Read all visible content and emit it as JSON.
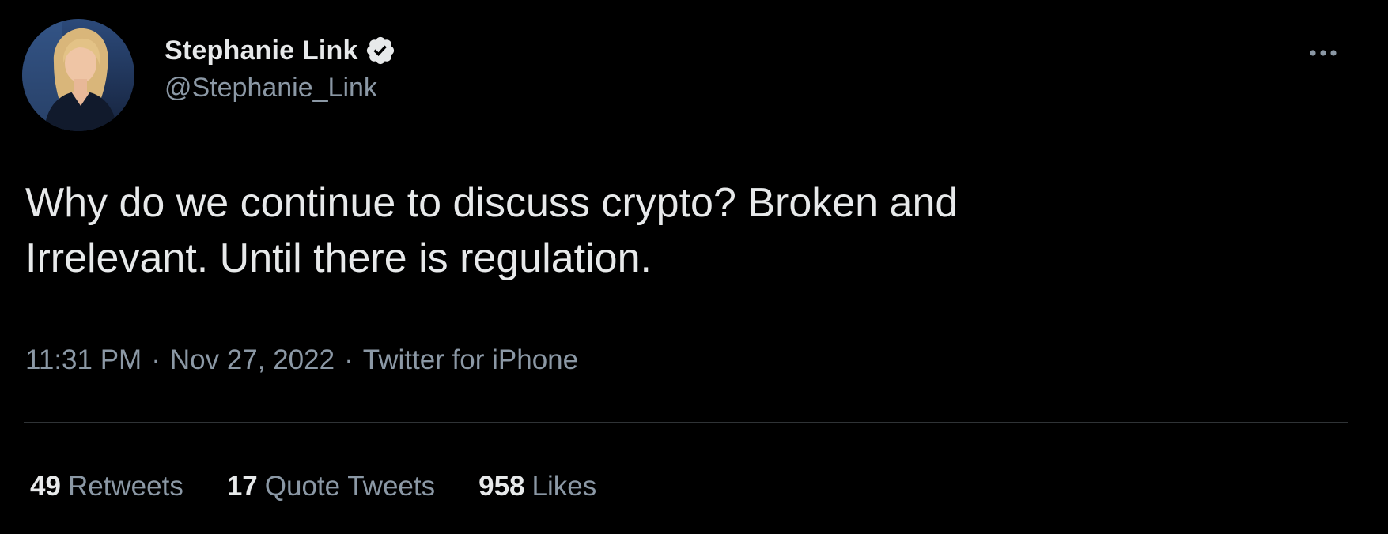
{
  "colors": {
    "background": "#000000",
    "primary_text": "#e7e9ea",
    "secondary_text": "#8b98a5",
    "divider": "#2f3336",
    "verified_badge": "#e7e9ea"
  },
  "tweet": {
    "author": {
      "display_name": "Stephanie Link",
      "handle": "@Stephanie_Link",
      "verified": true,
      "avatar_icon": "profile-photo"
    },
    "more_icon": "more-horizontal-icon",
    "text": "Why do we continue to discuss crypto? Broken and\nIrrelevant. Until there is regulation.",
    "meta": {
      "time": "11:31 PM",
      "separator": "·",
      "date": "Nov 27, 2022",
      "source": "Twitter for iPhone"
    },
    "stats": [
      {
        "count": "49",
        "label": "Retweets"
      },
      {
        "count": "17",
        "label": "Quote Tweets"
      },
      {
        "count": "958",
        "label": "Likes"
      }
    ]
  }
}
